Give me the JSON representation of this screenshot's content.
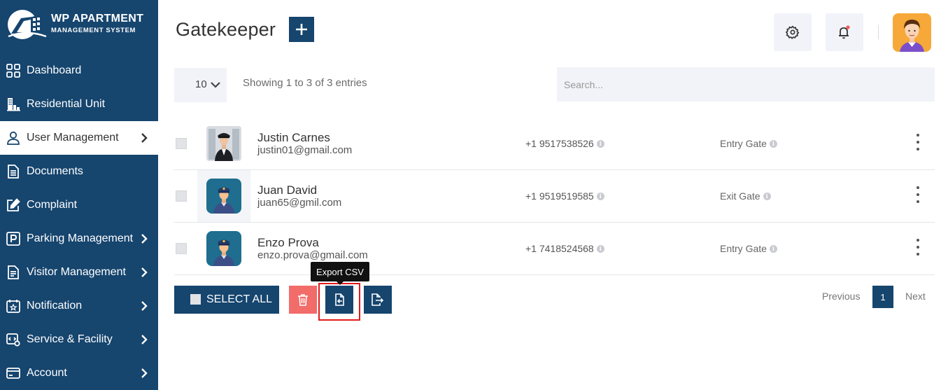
{
  "sidebar": {
    "logo": {
      "title": "WP APARTMENT",
      "subtitle": "MANAGEMENT SYSTEM"
    },
    "items": [
      {
        "label": "Dashboard",
        "icon": "dashboard-icon",
        "chevron": false,
        "active": false
      },
      {
        "label": "Residential Unit",
        "icon": "building-icon",
        "chevron": false,
        "active": false
      },
      {
        "label": "User Management",
        "icon": "user-icon",
        "chevron": true,
        "active": true
      },
      {
        "label": "Documents",
        "icon": "document-icon",
        "chevron": false,
        "active": false
      },
      {
        "label": "Complaint",
        "icon": "edit-icon",
        "chevron": false,
        "active": false
      },
      {
        "label": "Parking Management",
        "icon": "parking-icon",
        "chevron": true,
        "active": false
      },
      {
        "label": "Visitor Management",
        "icon": "visitor-doc-icon",
        "chevron": true,
        "active": false
      },
      {
        "label": "Notification",
        "icon": "calendar-star-icon",
        "chevron": true,
        "active": false
      },
      {
        "label": "Service & Facility",
        "icon": "service-icon",
        "chevron": true,
        "active": false
      },
      {
        "label": "Account",
        "icon": "account-card-icon",
        "chevron": true,
        "active": false
      }
    ]
  },
  "header": {
    "title": "Gatekeeper",
    "add_icon": "plus-icon",
    "settings_icon": "gear-icon",
    "notification_icon": "bell-icon",
    "accent": "#16456e"
  },
  "table_controls": {
    "entries_value": "10",
    "showing_text": "Showing 1 to 3 of 3 entries",
    "search_placeholder": "Search..."
  },
  "rows": [
    {
      "name": "Justin Carnes",
      "email": "justin01@gmail.com",
      "phone": "+1 9517538526",
      "gate": "Entry Gate",
      "photo": "guard-photo"
    },
    {
      "name": "Juan David",
      "email": "juan65@gmil.com",
      "phone": "+1 9519519585",
      "gate": "Exit Gate",
      "photo": "guard-avatar"
    },
    {
      "name": "Enzo Prova",
      "email": "enzo.prova@gmail.com",
      "phone": "+1 7418524568",
      "gate": "Entry Gate",
      "photo": "guard-avatar"
    }
  ],
  "actions": {
    "select_all_label": "SELECT ALL",
    "delete_color": "#f26c6a",
    "tooltip": "Export CSV"
  },
  "pagination": {
    "previous": "Previous",
    "current": "1",
    "next": "Next"
  }
}
